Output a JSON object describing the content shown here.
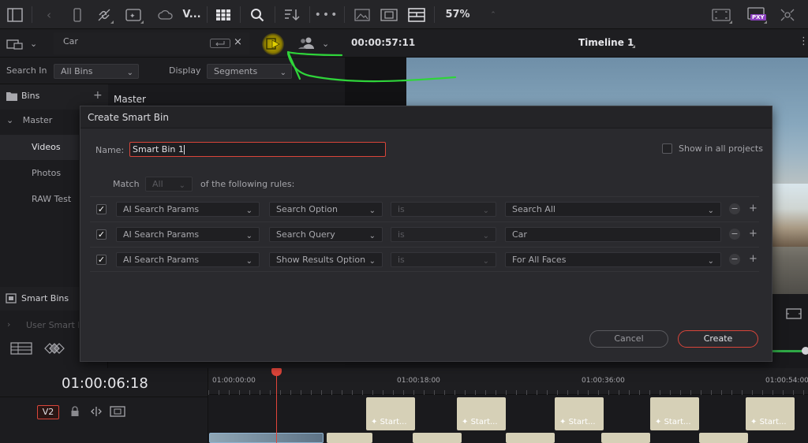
{
  "toolbar": {
    "v_label": "V...",
    "zoom_label": "57%",
    "pxy_badge": "PXY"
  },
  "search": {
    "value": "Car",
    "search_in_label": "Search In",
    "search_in_value": "All Bins",
    "display_label": "Display",
    "display_value": "Segments"
  },
  "viewer": {
    "timecode": "00:00:57:11",
    "timeline_name": "Timeline 1"
  },
  "bins": {
    "header": "Bins",
    "add": "+",
    "items": [
      {
        "label": "Master"
      },
      {
        "label": "Videos"
      },
      {
        "label": "Photos"
      },
      {
        "label": "RAW Test"
      }
    ],
    "smart_bins_label": "Smart Bins",
    "user_smart_bins_label": "User Smart B"
  },
  "media_pool": {
    "title": "Master"
  },
  "dialog": {
    "title": "Create Smart Bin",
    "name_label": "Name:",
    "name_value": "Smart Bin 1",
    "show_all_projects": "Show in all projects",
    "match_label": "Match",
    "match_value": "All",
    "rules_suffix": "of the following rules:",
    "rules": [
      {
        "field": "AI Search Params",
        "param": "Search Option",
        "op": "is",
        "value": "Search All",
        "value_dropdown": true
      },
      {
        "field": "AI Search Params",
        "param": "Search Query",
        "op": "is",
        "value": "Car",
        "value_dropdown": false
      },
      {
        "field": "AI Search Params",
        "param": "Show Results Option",
        "op": "is",
        "value": "For All Faces",
        "value_dropdown": true
      }
    ],
    "minus": "−",
    "plus": "+",
    "cancel": "Cancel",
    "create": "Create"
  },
  "timeline": {
    "timecode": "01:00:06:18",
    "track_label": "V2",
    "ruler": [
      "01:00:00:00",
      "01:00:18:00",
      "01:00:36:00",
      "01:00:54:00"
    ],
    "clip_label": "Start..."
  },
  "colors": {
    "accent_red": "#d9453a",
    "annotation_green": "#2fd43a",
    "highlight_yellow": "#d8c200",
    "pxy_purple": "#8b3fbf"
  }
}
